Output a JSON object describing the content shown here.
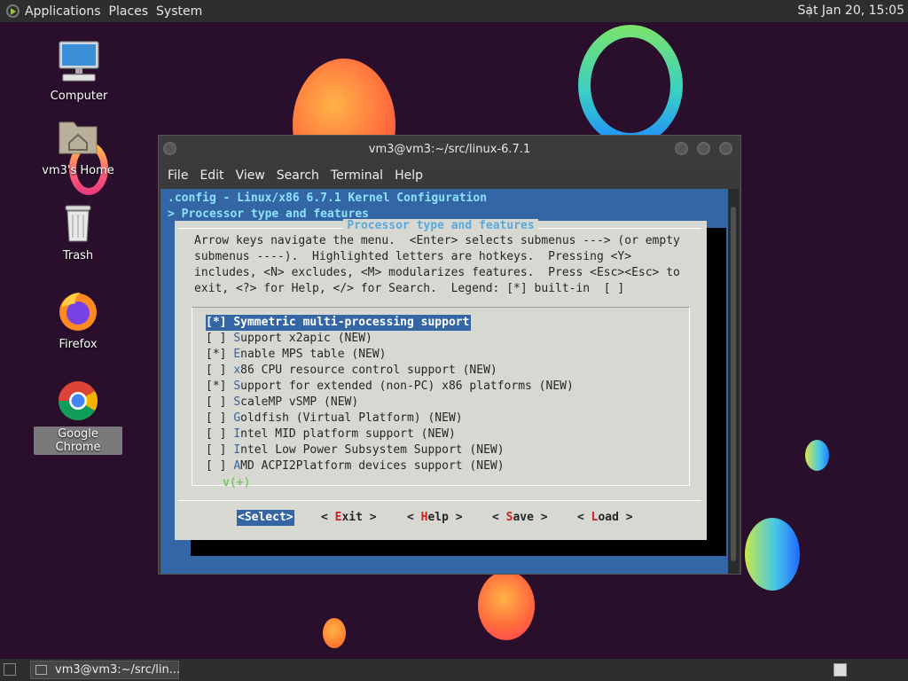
{
  "top_panel": {
    "menus": [
      "Applications",
      "Places",
      "System"
    ],
    "clock": "Sat Jan 20, 15:05"
  },
  "desktop": {
    "icons": [
      {
        "label": "Computer",
        "icon": "computer-icon"
      },
      {
        "label": "vm3's Home",
        "icon": "home-folder-icon"
      },
      {
        "label": "Trash",
        "icon": "trash-icon"
      },
      {
        "label": "Firefox",
        "icon": "firefox-icon"
      },
      {
        "label": "Google Chrome",
        "icon": "chrome-icon"
      }
    ]
  },
  "terminal": {
    "title": "vm3@vm3:~/src/linux-6.7.1",
    "menu": [
      "File",
      "Edit",
      "View",
      "Search",
      "Terminal",
      "Help"
    ],
    "header_line1": ".config - Linux/x86 6.7.1 Kernel Configuration",
    "header_line2": "> Processor type and features",
    "dialog": {
      "title": "Processor type and features",
      "help_text": "Arrow keys navigate the menu.  <Enter> selects submenus ---> (or empty\nsubmenus ----).  Highlighted letters are hotkeys.  Pressing <Y>\nincludes, <N> excludes, <M> modularizes features.  Press <Esc><Esc> to\nexit, <?> for Help, </> for Search.  Legend: [*] built-in  [ ]",
      "items": [
        {
          "check": "[*]",
          "hot": "S",
          "rest": "ymmetric multi-processing support",
          "selected": true
        },
        {
          "check": "[ ]",
          "hot": "S",
          "rest": "upport x2apic (NEW)",
          "selected": false
        },
        {
          "check": "[*]",
          "hot": "E",
          "rest": "nable MPS table (NEW)",
          "selected": false
        },
        {
          "check": "[ ]",
          "hot": "x",
          "rest": "86 CPU resource control support (NEW)",
          "selected": false
        },
        {
          "check": "[*]",
          "hot": "S",
          "rest": "upport for extended (non-PC) x86 platforms (NEW)",
          "selected": false
        },
        {
          "check": "[ ]",
          "hot": "S",
          "rest": "caleMP vSMP (NEW)",
          "selected": false
        },
        {
          "check": "[ ]",
          "hot": "G",
          "rest": "oldfish (Virtual Platform) (NEW)",
          "selected": false
        },
        {
          "check": "[ ]",
          "hot": "I",
          "rest": "ntel MID platform support (NEW)",
          "selected": false
        },
        {
          "check": "[ ]",
          "hot": "I",
          "rest": "ntel Low Power Subsystem Support (NEW)",
          "selected": false
        },
        {
          "check": "[ ]",
          "hot": "A",
          "rest": "MD ACPI2Platform devices support (NEW)",
          "selected": false
        }
      ],
      "more_indicator": "v(+)",
      "buttons": [
        {
          "pre": "<",
          "hot": "S",
          "rest": "elect>",
          "selected": true
        },
        {
          "pre": "< ",
          "hot": "E",
          "rest": "xit >",
          "selected": false
        },
        {
          "pre": "< ",
          "hot": "H",
          "rest": "elp >",
          "selected": false
        },
        {
          "pre": "< ",
          "hot": "S",
          "rest": "ave >",
          "selected": false
        },
        {
          "pre": "< ",
          "hot": "L",
          "rest": "oad >",
          "selected": false
        }
      ]
    }
  },
  "taskbar": {
    "task_label": "vm3@vm3:~/src/lin..."
  },
  "colors": {
    "terminal_bg": "#3465a4",
    "dialog_bg": "#d8d8d2",
    "hotkey": "#3465a4",
    "button_hotkey": "#cc2222"
  }
}
